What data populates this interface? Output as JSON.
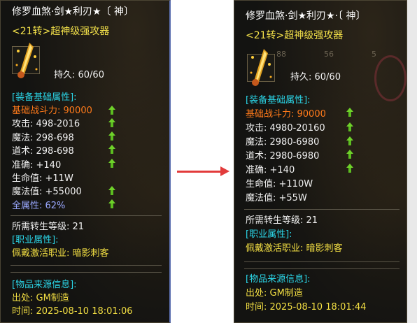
{
  "left": {
    "title": "修罗血煞·剑★利刃★〔 神〕",
    "subtitle": "<21转>超神级强攻器",
    "durability": "持久:  60/60",
    "section_base": "[装备基础属性]:",
    "power": "基础战斗力:  90000",
    "attack": "攻击:  498-2016",
    "magic": "魔法:  298-698",
    "tao": "道术:  298-698",
    "accuracy": "准确:  +140",
    "hp": "生命值:  +11W",
    "mp": "魔法值:  +55000",
    "all_attr": "全属性:  62%",
    "rebirth_req": "所需转生等级:  21",
    "section_job": "[职业属性]:",
    "job": "佩戴激活职业:  暗影刺客",
    "section_source": "[物品来源信息]:",
    "source": "出处:  GM制造",
    "time": "时间:  2025-08-10 18:01:06"
  },
  "right": {
    "title": "修罗血煞·剑★利刃★·〔 神〕",
    "subtitle": "<21转>超神级强攻器",
    "durability": "持久:  60/60",
    "section_base": "[装备基础属性]:",
    "power": "基础战斗力:  90000",
    "attack": "攻击:  4980-20160",
    "magic": "魔法:  2980-6980",
    "tao": "道术:  2980-6980",
    "accuracy": "准确:  +140",
    "hp": "生命值:  +110W",
    "mp": "魔法值:  +55W",
    "rebirth_req": "所需转生等级:  21",
    "section_job": "[职业属性]:",
    "job": "佩戴激活职业:  暗影刺客",
    "section_source": "[物品来源信息]:",
    "source": "出处:  GM制造",
    "time": "时间:  2025-08-10 18:01:44"
  },
  "background_labels": [
    "88",
    "56",
    "5"
  ],
  "colors": {
    "title": "#ffffff",
    "subtitle": "#f4e24a",
    "section": "#2bd6e8",
    "power": "#ff7a1a",
    "all_attr": "#9aa8ff",
    "job": "#f3df43",
    "upgrade_arrow": "#6fd22a",
    "compare_arrow": "#e23b3b"
  },
  "icons": {
    "item": "sword-icon",
    "upgrade": "up-arrow-icon",
    "compare": "right-arrow-icon"
  }
}
